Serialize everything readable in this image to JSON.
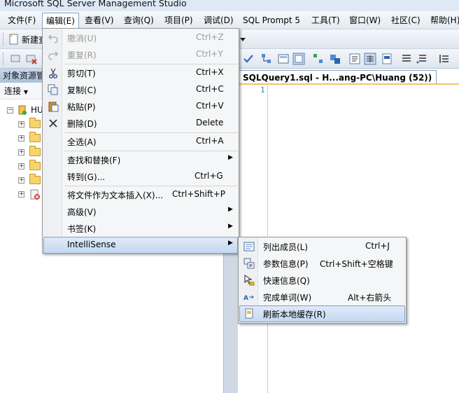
{
  "window": {
    "title": "Microsoft SQL Server Management Studio"
  },
  "menubar": {
    "items": [
      "文件(F)",
      "编辑(E)",
      "查看(V)",
      "查询(Q)",
      "项目(P)",
      "调试(D)",
      "SQL Prompt 5",
      "工具(T)",
      "窗口(W)",
      "社区(C)",
      "帮助(H)"
    ],
    "active": "编辑(E)"
  },
  "toolbar": {
    "new_query_label": "新建查"
  },
  "object_explorer": {
    "title": "对象资源管",
    "connect_label": "连接",
    "server_label": "HU"
  },
  "editor": {
    "tab_label": "SQLQuery1.sql - H...ang-PC\\Huang (52))",
    "line_number": "1"
  },
  "edit_menu": {
    "items": [
      {
        "label": "撤消(U)",
        "shortcut": "Ctrl+Z",
        "icon": "undo-icon",
        "disabled": true
      },
      {
        "label": "重复(R)",
        "shortcut": "Ctrl+Y",
        "icon": "redo-icon",
        "disabled": true
      },
      {
        "label": "剪切(T)",
        "shortcut": "Ctrl+X",
        "icon": "scissors-icon"
      },
      {
        "label": "复制(C)",
        "shortcut": "Ctrl+C",
        "icon": "copy-icon"
      },
      {
        "label": "粘贴(P)",
        "shortcut": "Ctrl+V",
        "icon": "paste-icon"
      },
      {
        "label": "删除(D)",
        "shortcut": "Delete",
        "icon": "delete-x-icon"
      },
      {
        "label": "全选(A)",
        "shortcut": "Ctrl+A"
      },
      {
        "label": "查找和替换(F)",
        "submenu": true
      },
      {
        "label": "转到(G)...",
        "shortcut": "Ctrl+G"
      },
      {
        "label": "将文件作为文本插入(X)...",
        "shortcut": "Ctrl+Shift+P"
      },
      {
        "label": "高级(V)",
        "submenu": true
      },
      {
        "label": "书签(K)",
        "submenu": true
      },
      {
        "label": "IntelliSense",
        "submenu": true,
        "highlighted": true
      }
    ]
  },
  "intellisense_menu": {
    "items": [
      {
        "label": "列出成员(L)",
        "shortcut": "Ctrl+J",
        "icon": "list-members-icon"
      },
      {
        "label": "参数信息(P)",
        "shortcut": "Ctrl+Shift+空格键",
        "icon": "parameter-info-icon"
      },
      {
        "label": "快速信息(Q)",
        "icon": "quick-info-icon"
      },
      {
        "label": "完成单词(W)",
        "shortcut": "Alt+右箭头",
        "icon": "complete-word-icon"
      },
      {
        "label": "刷新本地缓存(R)",
        "icon": "refresh-cache-icon",
        "highlighted": true
      }
    ]
  },
  "colors": {
    "highlight_border": "#7da2ce",
    "highlight_fill": "#c5d9f1",
    "menu_bg": "#f5f6f7"
  }
}
